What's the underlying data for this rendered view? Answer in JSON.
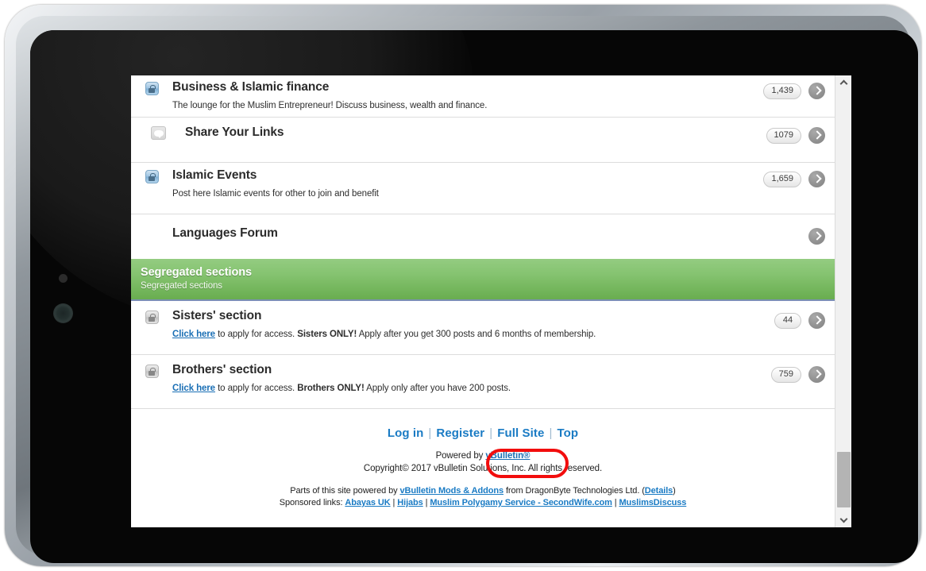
{
  "forum": {
    "rows": [
      {
        "id": "business-islamic-finance",
        "icon": "lock-blue-icon",
        "title": "Business & Islamic finance",
        "desc_plain": "The lounge for the Muslim Entrepreneur! Discuss business, wealth and finance.",
        "count": "1,439",
        "has_chevron": true
      },
      {
        "id": "share-your-links",
        "icon": "speech-bubble-icon",
        "title": "Share Your Links",
        "desc_plain": "",
        "count": "1079",
        "has_chevron": true
      },
      {
        "id": "islamic-events",
        "icon": "lock-blue-icon",
        "title": "Islamic Events",
        "desc_plain": "Post here Islamic events for other to join and benefit",
        "count": "1,659",
        "has_chevron": true
      },
      {
        "id": "languages-forum",
        "icon": "",
        "title": "Languages Forum",
        "desc_plain": "",
        "count": "",
        "has_chevron": true
      }
    ],
    "category": {
      "title": "Segregated sections",
      "subtitle": "Segregated sections"
    },
    "segregated_rows": [
      {
        "id": "sisters-section",
        "icon": "lock-gray-icon",
        "title": "Sisters' section",
        "link_label": "Click here",
        "desc_mid": " to apply for access. ",
        "desc_bold": "Sisters ONLY!",
        "desc_tail": " Apply after you get 300 posts and 6 months of membership.",
        "count": "44",
        "has_chevron": true
      },
      {
        "id": "brothers-section",
        "icon": "lock-gray-icon",
        "title": "Brothers' section",
        "link_label": "Click here",
        "desc_mid": " to apply for access. ",
        "desc_bold": "Brothers ONLY!",
        "desc_tail": " Apply only after you have 200 posts.",
        "count": "759",
        "has_chevron": true
      }
    ]
  },
  "footer": {
    "nav": {
      "login": "Log in",
      "register": "Register",
      "full_site": "Full Site",
      "top": "Top",
      "separator": "|"
    },
    "powered_by_prefix": "Powered by ",
    "powered_by_link": "vBulletin®",
    "copyright": "Copyright© 2017 vBulletin Solutions, Inc. All rights reserved.",
    "mods_prefix": "Parts of this site powered by ",
    "mods_link": "vBulletin Mods & Addons",
    "mods_mid": " from DragonByte Technologies Ltd. (",
    "mods_details_link": "Details",
    "mods_suffix": ")",
    "sponsored_label": "Sponsored links: ",
    "sponsored_links": [
      "Abayas UK",
      "Hijabs",
      "Muslim Polygamy Service - SecondWife.com",
      "MuslimsDiscuss"
    ],
    "sponsored_sep": " | "
  },
  "scrollbar": {
    "up_arrow": "scroll-up",
    "down_arrow": "scroll-down",
    "thumb": "scroll-thumb"
  },
  "annotation": {
    "target": "Full Site",
    "color": "#f20d0d"
  },
  "theme": {
    "link_blue": "#1a7bc4",
    "category_green_top": "#94cc81",
    "category_green_bottom": "#69ad50",
    "row_border": "#dcdcdc",
    "bezel_silver": "#b9c0c6",
    "screen_black": "#060606"
  }
}
